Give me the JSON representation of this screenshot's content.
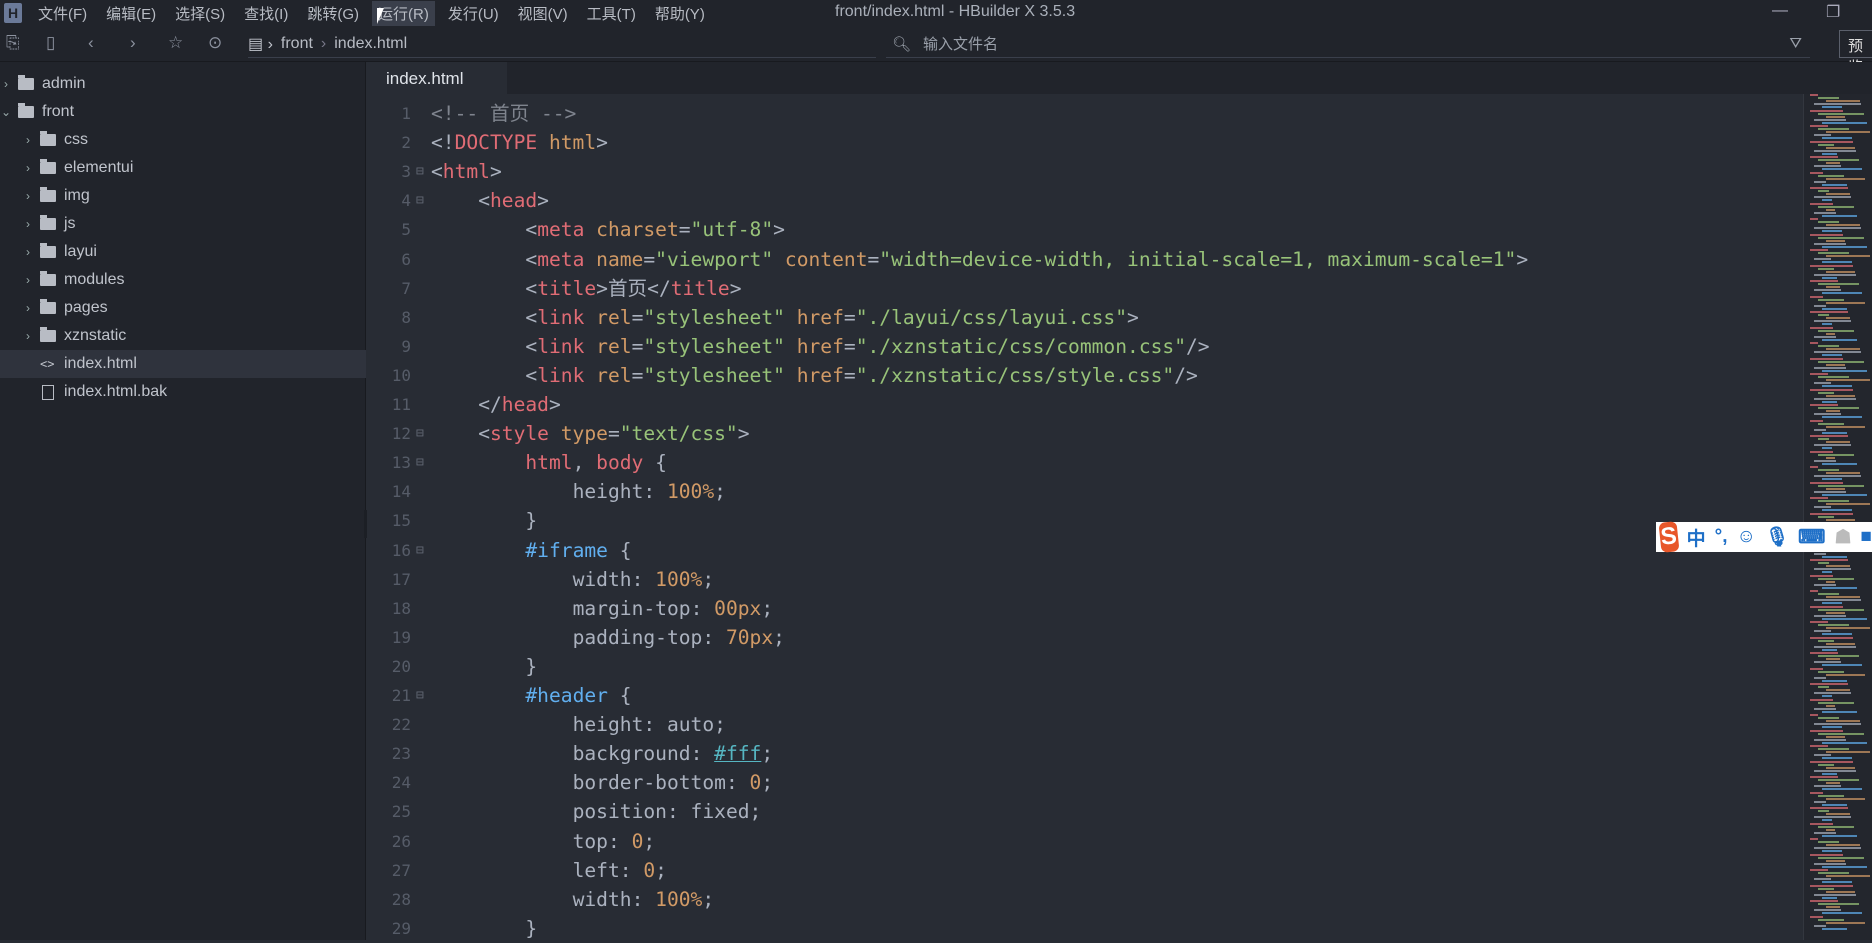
{
  "menubar": {
    "items": [
      "文件(F)",
      "编辑(E)",
      "选择(S)",
      "查找(I)",
      "跳转(G)",
      "运行(R)",
      "发行(U)",
      "视图(V)",
      "工具(T)",
      "帮助(Y)"
    ],
    "active_index": 5,
    "title": "front/index.html - HBuilder X 3.5.3"
  },
  "toolbar": {
    "breadcrumb": [
      "front",
      "index.html"
    ],
    "search_placeholder": "输入文件名",
    "preview_label": "预览"
  },
  "sidebar": {
    "nodes": [
      {
        "label": "admin",
        "type": "folder",
        "depth": 0,
        "expanded": false
      },
      {
        "label": "front",
        "type": "folder",
        "depth": 0,
        "expanded": true
      },
      {
        "label": "css",
        "type": "folder",
        "depth": 1,
        "expanded": false
      },
      {
        "label": "elementui",
        "type": "folder",
        "depth": 1,
        "expanded": false
      },
      {
        "label": "img",
        "type": "folder",
        "depth": 1,
        "expanded": false
      },
      {
        "label": "js",
        "type": "folder",
        "depth": 1,
        "expanded": false
      },
      {
        "label": "layui",
        "type": "folder",
        "depth": 1,
        "expanded": false
      },
      {
        "label": "modules",
        "type": "folder",
        "depth": 1,
        "expanded": false
      },
      {
        "label": "pages",
        "type": "folder",
        "depth": 1,
        "expanded": false
      },
      {
        "label": "xznstatic",
        "type": "folder",
        "depth": 1,
        "expanded": false
      },
      {
        "label": "index.html",
        "type": "html",
        "depth": 1,
        "selected": true
      },
      {
        "label": "index.html.bak",
        "type": "file",
        "depth": 1
      }
    ]
  },
  "editor": {
    "tab": "index.html",
    "lines": [
      {
        "n": "1",
        "indent": 0,
        "tokens": [
          [
            "com",
            "<!-- 首页 -->"
          ]
        ]
      },
      {
        "n": "2",
        "indent": 0,
        "tokens": [
          [
            "p",
            "<!"
          ],
          [
            "tag",
            "DOCTYPE"
          ],
          [
            "p",
            " "
          ],
          [
            "attr",
            "html"
          ],
          [
            "p",
            ">"
          ]
        ]
      },
      {
        "n": "3",
        "indent": 0,
        "fold": true,
        "tokens": [
          [
            "p",
            "<"
          ],
          [
            "tag",
            "html"
          ],
          [
            "p",
            ">"
          ]
        ]
      },
      {
        "n": "4",
        "indent": 1,
        "fold": true,
        "tokens": [
          [
            "p",
            "<"
          ],
          [
            "tag",
            "head"
          ],
          [
            "p",
            ">"
          ]
        ]
      },
      {
        "n": "5",
        "indent": 2,
        "tokens": [
          [
            "p",
            "<"
          ],
          [
            "tag",
            "meta"
          ],
          [
            "p",
            " "
          ],
          [
            "attr",
            "charset"
          ],
          [
            "p",
            "="
          ],
          [
            "str",
            "\"utf-8\""
          ],
          [
            "p",
            ">"
          ]
        ]
      },
      {
        "n": "6",
        "indent": 2,
        "tokens": [
          [
            "p",
            "<"
          ],
          [
            "tag",
            "meta"
          ],
          [
            "p",
            " "
          ],
          [
            "attr",
            "name"
          ],
          [
            "p",
            "="
          ],
          [
            "str",
            "\"viewport\""
          ],
          [
            "p",
            " "
          ],
          [
            "attr",
            "content"
          ],
          [
            "p",
            "="
          ],
          [
            "str",
            "\"width=device-width, initial-scale=1, maximum-scale=1\""
          ],
          [
            "p",
            ">"
          ]
        ]
      },
      {
        "n": "7",
        "indent": 2,
        "tokens": [
          [
            "p",
            "<"
          ],
          [
            "tag",
            "title"
          ],
          [
            "p",
            ">"
          ],
          [
            "txt",
            "首页"
          ],
          [
            "p",
            "</"
          ],
          [
            "tag",
            "title"
          ],
          [
            "p",
            ">"
          ]
        ]
      },
      {
        "n": "8",
        "indent": 2,
        "tokens": [
          [
            "p",
            "<"
          ],
          [
            "tag",
            "link"
          ],
          [
            "p",
            " "
          ],
          [
            "attr",
            "rel"
          ],
          [
            "p",
            "="
          ],
          [
            "str",
            "\"stylesheet\""
          ],
          [
            "p",
            " "
          ],
          [
            "attr",
            "href"
          ],
          [
            "p",
            "="
          ],
          [
            "str",
            "\"./layui/css/layui.css\""
          ],
          [
            "p",
            ">"
          ]
        ]
      },
      {
        "n": "9",
        "indent": 2,
        "tokens": [
          [
            "p",
            "<"
          ],
          [
            "tag",
            "link"
          ],
          [
            "p",
            " "
          ],
          [
            "attr",
            "rel"
          ],
          [
            "p",
            "="
          ],
          [
            "str",
            "\"stylesheet\""
          ],
          [
            "p",
            " "
          ],
          [
            "attr",
            "href"
          ],
          [
            "p",
            "="
          ],
          [
            "str",
            "\"./xznstatic/css/common.css\""
          ],
          [
            "p",
            "/>"
          ]
        ]
      },
      {
        "n": "10",
        "indent": 2,
        "tokens": [
          [
            "p",
            "<"
          ],
          [
            "tag",
            "link"
          ],
          [
            "p",
            " "
          ],
          [
            "attr",
            "rel"
          ],
          [
            "p",
            "="
          ],
          [
            "str",
            "\"stylesheet\""
          ],
          [
            "p",
            " "
          ],
          [
            "attr",
            "href"
          ],
          [
            "p",
            "="
          ],
          [
            "str",
            "\"./xznstatic/css/style.css\""
          ],
          [
            "p",
            "/>"
          ]
        ]
      },
      {
        "n": "11",
        "indent": 1,
        "tokens": [
          [
            "p",
            "</"
          ],
          [
            "tag",
            "head"
          ],
          [
            "p",
            ">"
          ]
        ]
      },
      {
        "n": "12",
        "indent": 1,
        "fold": true,
        "tokens": [
          [
            "p",
            "<"
          ],
          [
            "tag",
            "style"
          ],
          [
            "p",
            " "
          ],
          [
            "attr",
            "type"
          ],
          [
            "p",
            "="
          ],
          [
            "str",
            "\"text/css\""
          ],
          [
            "p",
            ">"
          ]
        ]
      },
      {
        "n": "13",
        "indent": 2,
        "fold": true,
        "tokens": [
          [
            "tag",
            "html"
          ],
          [
            "p",
            ", "
          ],
          [
            "tag",
            "body"
          ],
          [
            "p",
            " {"
          ]
        ]
      },
      {
        "n": "14",
        "indent": 3,
        "tokens": [
          [
            "prop",
            "height"
          ],
          [
            "p",
            ": "
          ],
          [
            "num",
            "100%"
          ],
          [
            "p",
            ";"
          ]
        ]
      },
      {
        "n": "15",
        "indent": 2,
        "tokens": [
          [
            "p",
            "}"
          ]
        ]
      },
      {
        "n": "16",
        "indent": 2,
        "fold": true,
        "tokens": [
          [
            "sel",
            "#iframe"
          ],
          [
            "p",
            " {"
          ]
        ]
      },
      {
        "n": "17",
        "indent": 3,
        "tokens": [
          [
            "prop",
            "width"
          ],
          [
            "p",
            ": "
          ],
          [
            "num",
            "100%"
          ],
          [
            "p",
            ";"
          ]
        ]
      },
      {
        "n": "18",
        "indent": 3,
        "tokens": [
          [
            "prop",
            "margin-top"
          ],
          [
            "p",
            ": "
          ],
          [
            "num",
            "00px"
          ],
          [
            "p",
            ";"
          ]
        ]
      },
      {
        "n": "19",
        "indent": 3,
        "tokens": [
          [
            "prop",
            "padding-top"
          ],
          [
            "p",
            ": "
          ],
          [
            "num",
            "70px"
          ],
          [
            "p",
            ";"
          ]
        ]
      },
      {
        "n": "20",
        "indent": 2,
        "tokens": [
          [
            "p",
            "}"
          ]
        ]
      },
      {
        "n": "21",
        "indent": 2,
        "fold": true,
        "tokens": [
          [
            "sel",
            "#header"
          ],
          [
            "p",
            " {"
          ]
        ]
      },
      {
        "n": "22",
        "indent": 3,
        "tokens": [
          [
            "prop",
            "height"
          ],
          [
            "p",
            ": auto;"
          ]
        ]
      },
      {
        "n": "23",
        "indent": 3,
        "tokens": [
          [
            "prop",
            "background"
          ],
          [
            "p",
            ": "
          ],
          [
            "col",
            "#fff"
          ],
          [
            "p",
            ";"
          ]
        ]
      },
      {
        "n": "24",
        "indent": 3,
        "tokens": [
          [
            "prop",
            "border-bottom"
          ],
          [
            "p",
            ": "
          ],
          [
            "num",
            "0"
          ],
          [
            "p",
            ";"
          ]
        ]
      },
      {
        "n": "25",
        "indent": 3,
        "tokens": [
          [
            "prop",
            "position"
          ],
          [
            "p",
            ": fixed;"
          ]
        ]
      },
      {
        "n": "26",
        "indent": 3,
        "tokens": [
          [
            "prop",
            "top"
          ],
          [
            "p",
            ": "
          ],
          [
            "num",
            "0"
          ],
          [
            "p",
            ";"
          ]
        ]
      },
      {
        "n": "27",
        "indent": 3,
        "tokens": [
          [
            "prop",
            "left"
          ],
          [
            "p",
            ": "
          ],
          [
            "num",
            "0"
          ],
          [
            "p",
            ";"
          ]
        ]
      },
      {
        "n": "28",
        "indent": 3,
        "tokens": [
          [
            "prop",
            "width"
          ],
          [
            "p",
            ": "
          ],
          [
            "num",
            "100%"
          ],
          [
            "p",
            ";"
          ]
        ]
      },
      {
        "n": "29",
        "indent": 2,
        "tokens": [
          [
            "p",
            "}"
          ]
        ]
      }
    ]
  },
  "ime": {
    "mode": "中",
    "punct": "°,"
  }
}
